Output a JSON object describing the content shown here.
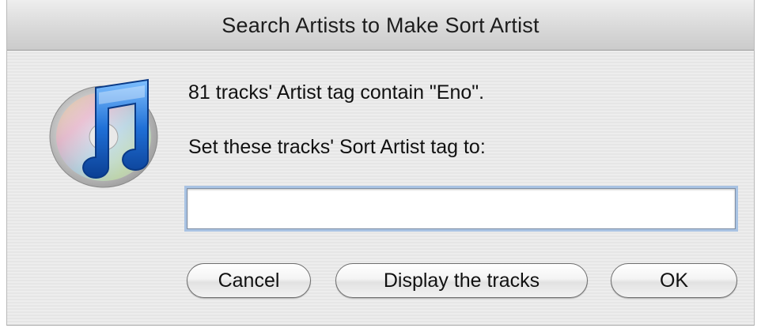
{
  "window": {
    "title": "Search Artists to Make Sort Artist"
  },
  "icon": {
    "name": "itunes-app-icon"
  },
  "message": {
    "line1": "81 tracks' Artist tag contain \"Eno\".",
    "line2": "Set these tracks' Sort Artist tag to:"
  },
  "input": {
    "value": "",
    "placeholder": ""
  },
  "buttons": {
    "cancel": "Cancel",
    "display": "Display the tracks",
    "ok": "OK"
  },
  "colors": {
    "focus_ring": "#a9c3e3",
    "note_blue": "#1f6fd6"
  }
}
